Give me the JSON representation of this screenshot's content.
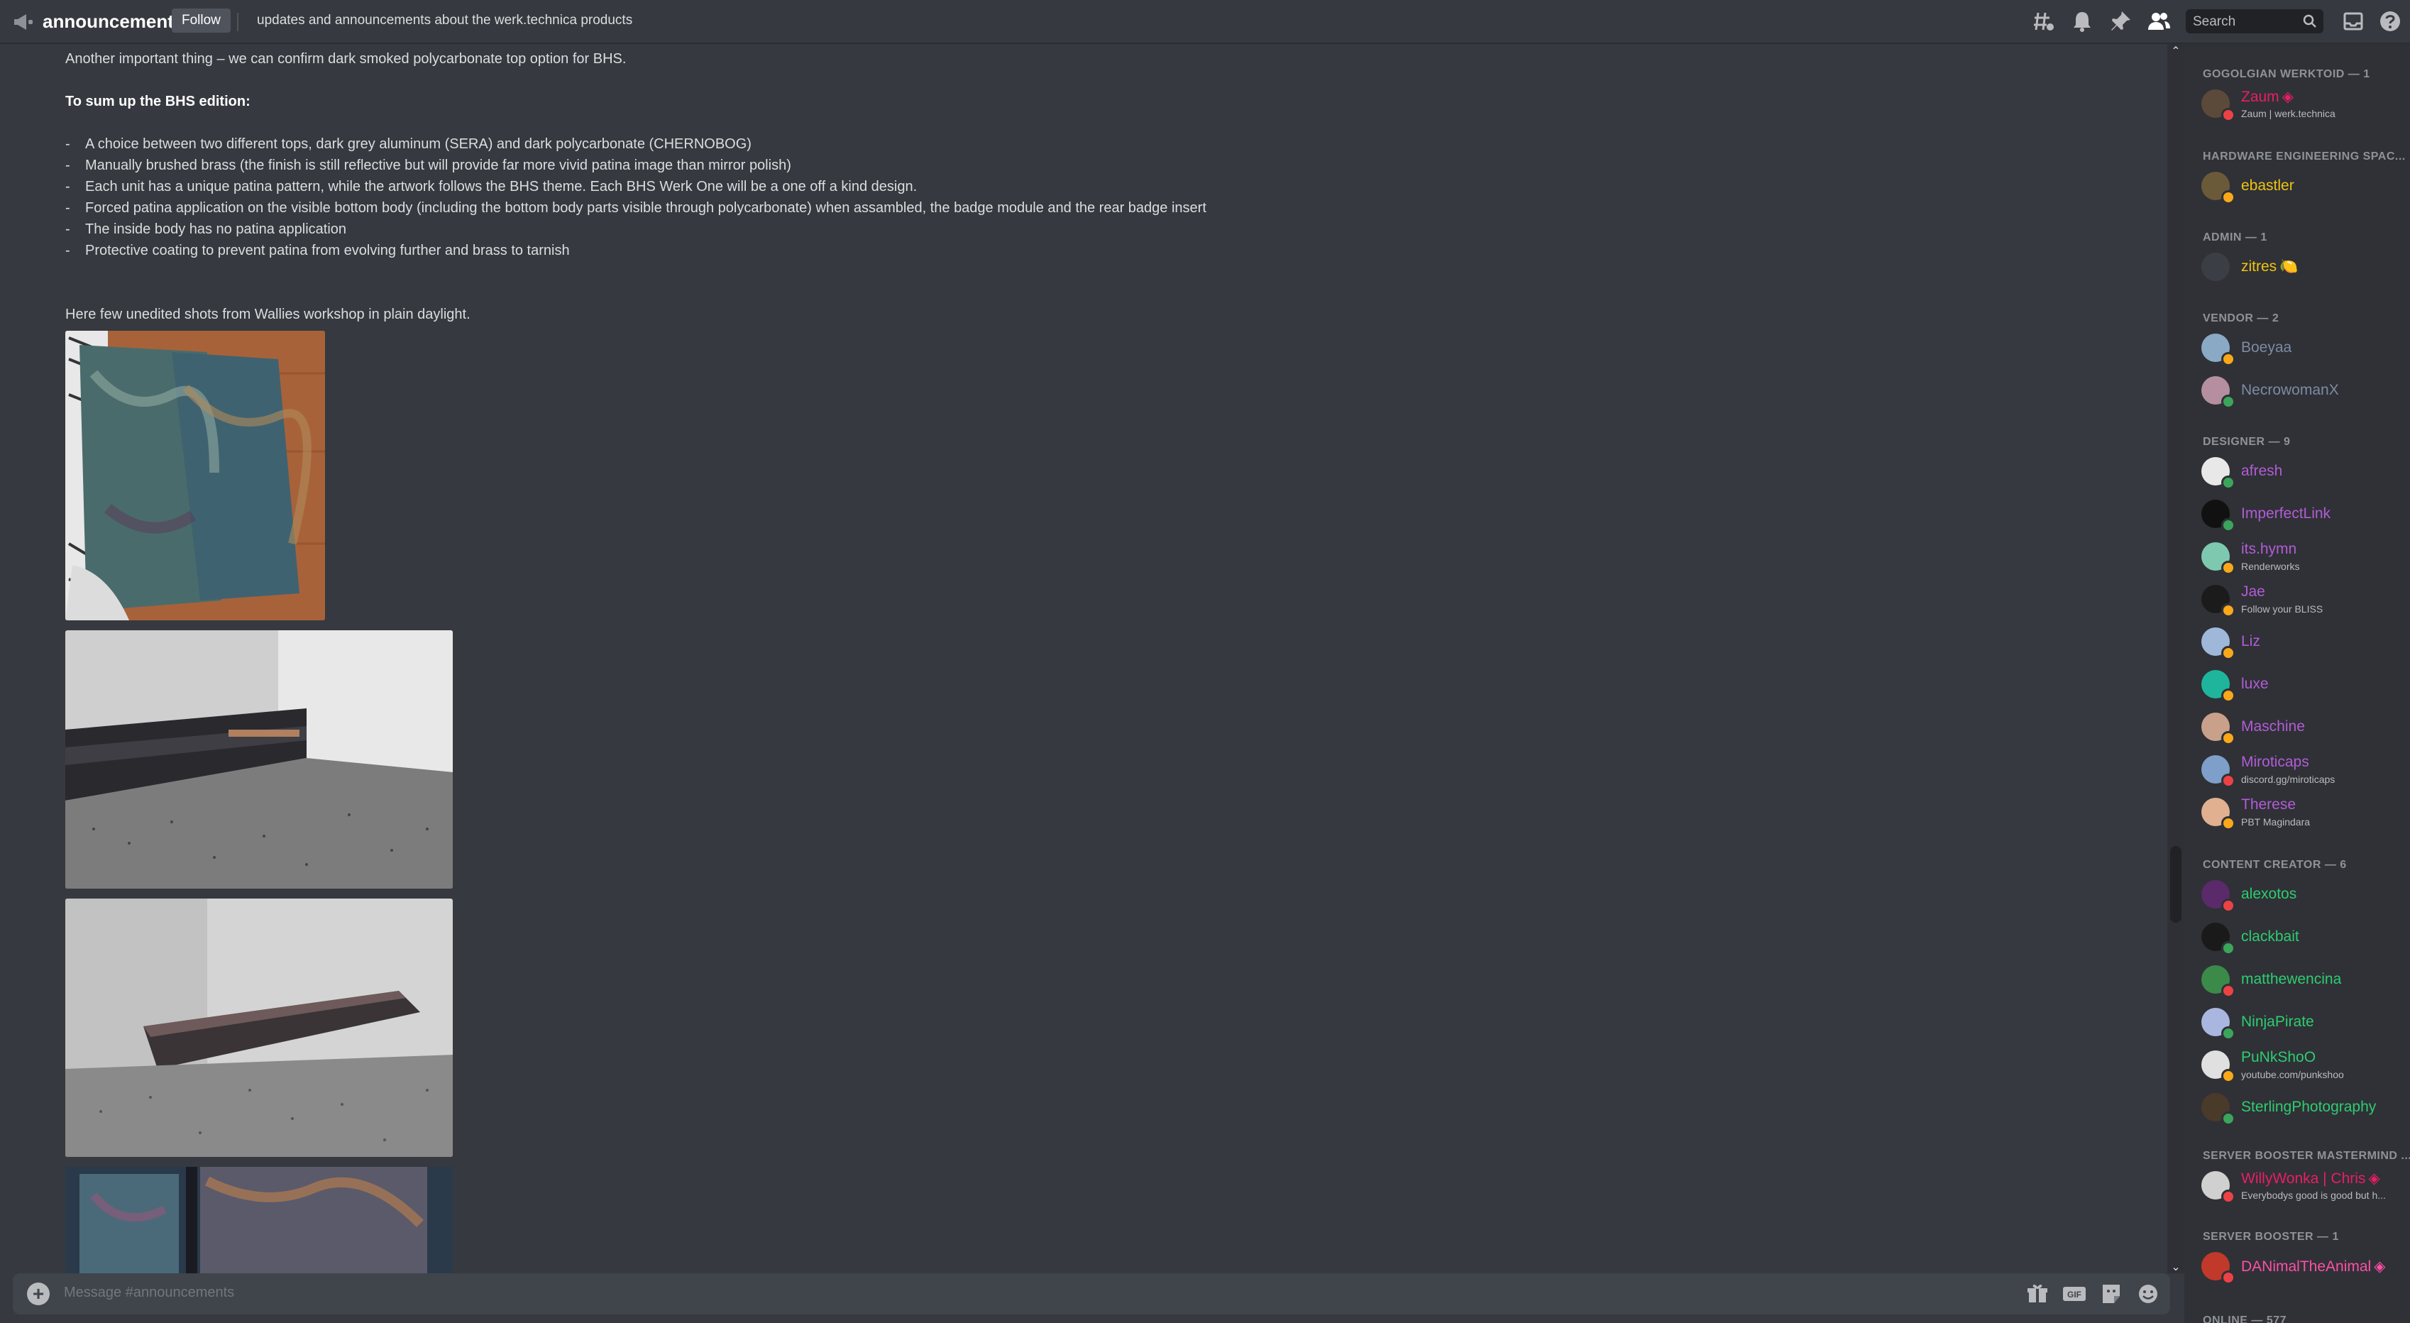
{
  "header": {
    "channel_name": "announcements",
    "follow_label": "Follow",
    "topic": "updates and announcements about the werk.technica products",
    "search_placeholder": "Search"
  },
  "icons": {
    "channel": "megaphone-icon",
    "threads": "threads-icon",
    "notifications": "bell-icon",
    "pins": "pin-icon",
    "members": "members-icon",
    "search": "search-icon",
    "inbox": "inbox-icon",
    "help": "help-icon"
  },
  "message": {
    "intro": "Another important thing – we can confirm dark smoked polycarbonate top option for BHS.",
    "summary_heading": "To sum up the BHS edition:",
    "bullets": [
      "A choice between two different tops, dark grey aluminum (SERA) and dark polycarbonate (CHERNOBOG)",
      "Manually brushed brass (the finish is still reflective but will provide far more vivid patina image than mirror polish)",
      "Each unit has a unique patina pattern, while the artwork follows the BHS theme. Each BHS Werk One will be a one off a kind design.",
      "Forced patina application on the visible bottom body (including the bottom body parts visible through polycarbonate) when assambled, the badge module and the rear badge insert",
      "The inside body has no patina application",
      "Protective coating to prevent patina from evolving further and brass to tarnish"
    ],
    "bullet_marker": "-",
    "photos_caption": "Here few unedited shots from Wallies workshop in plain daylight."
  },
  "composer": {
    "placeholder": "Message #announcements"
  },
  "members": {
    "groups": [
      {
        "title": "GOGOLGIAN WERKTOID — 1",
        "members": [
          {
            "name": "Zaum",
            "sub": "Zaum | werk.technica",
            "color": "#e91e63",
            "status": "#ed4245",
            "avatar": "#5b4a3a",
            "badge": "◈"
          }
        ]
      },
      {
        "title": "HARDWARE ENGINEERING SPAC...",
        "members": [
          {
            "name": "ebastler",
            "sub": "",
            "color": "#f1c40f",
            "status": "#faa81a",
            "avatar": "#6b5a3a"
          }
        ]
      },
      {
        "title": "ADMIN — 1",
        "members": [
          {
            "name": "zitres",
            "sub": "",
            "color": "#f1c40f",
            "status": "",
            "avatar": "#3b3e44",
            "badge": "🍋"
          }
        ]
      },
      {
        "title": "VENDOR — 2",
        "members": [
          {
            "name": "Boeyaa",
            "sub": "",
            "color": "#7e8aa3",
            "status": "#faa81a",
            "avatar": "#8aa9c4"
          },
          {
            "name": "NecrowomanX",
            "sub": "",
            "color": "#7e8aa3",
            "status": "#3ba55c",
            "avatar": "#b58fa0"
          }
        ]
      },
      {
        "title": "DESIGNER — 9",
        "members": [
          {
            "name": "afresh",
            "sub": "",
            "color": "#b25cd6",
            "status": "#3ba55c",
            "avatar": "#e8e8e8"
          },
          {
            "name": "ImperfectLink",
            "sub": "",
            "color": "#b25cd6",
            "status": "#3ba55c",
            "avatar": "#111111"
          },
          {
            "name": "its.hymn",
            "sub": "Renderworks",
            "color": "#b25cd6",
            "status": "#faa81a",
            "avatar": "#7ec8b0"
          },
          {
            "name": "Jae",
            "sub": "Follow your BLISS",
            "color": "#b25cd6",
            "status": "#faa81a",
            "avatar": "#1b1b1b"
          },
          {
            "name": "Liz",
            "sub": "",
            "color": "#b25cd6",
            "status": "#faa81a",
            "avatar": "#9fb7d9"
          },
          {
            "name": "luxe",
            "sub": "",
            "color": "#b25cd6",
            "status": "#faa81a",
            "avatar": "#1fb59c"
          },
          {
            "name": "Maschine",
            "sub": "",
            "color": "#b25cd6",
            "status": "#faa81a",
            "avatar": "#c9a08a"
          },
          {
            "name": "Miroticaps",
            "sub": "discord.gg/miroticaps",
            "color": "#b25cd6",
            "status": "#ed4245",
            "avatar": "#7d9fc9"
          },
          {
            "name": "Therese",
            "sub": "PBT Magindara",
            "color": "#b25cd6",
            "status": "#faa81a",
            "avatar": "#e0b090"
          }
        ]
      },
      {
        "title": "CONTENT CREATOR — 6",
        "members": [
          {
            "name": "alexotos",
            "sub": "",
            "color": "#2ecc71",
            "status": "#ed4245",
            "avatar": "#5a2a6a"
          },
          {
            "name": "clackbait",
            "sub": "",
            "color": "#2ecc71",
            "status": "#3ba55c",
            "avatar": "#1a1a1a"
          },
          {
            "name": "matthewencina",
            "sub": "",
            "color": "#2ecc71",
            "status": "#ed4245",
            "avatar": "#3b8a4a"
          },
          {
            "name": "NinjaPirate",
            "sub": "",
            "color": "#2ecc71",
            "status": "#3ba55c",
            "avatar": "#a9b7e0"
          },
          {
            "name": "PuNkShoO",
            "sub": "youtube.com/punkshoo",
            "color": "#2ecc71",
            "status": "#faa81a",
            "avatar": "#e0e0e0"
          },
          {
            "name": "SterlingPhotography",
            "sub": "",
            "color": "#2ecc71",
            "status": "#3ba55c",
            "avatar": "#4a3a2a"
          }
        ]
      },
      {
        "title": "SERVER BOOSTER MASTERMIND ...",
        "members": [
          {
            "name": "WillyWonka | Chris",
            "sub": "Everybodys good is good but h...",
            "color": "#e91e63",
            "status": "#ed4245",
            "avatar": "#d0d0d0",
            "badge": "◈"
          }
        ]
      },
      {
        "title": "SERVER BOOSTER — 1",
        "members": [
          {
            "name": "DANimalTheAnimal",
            "sub": "",
            "color": "#ff4fa8",
            "status": "#ed4245",
            "avatar": "#c0392b",
            "badge": "◈"
          }
        ]
      },
      {
        "title": "ONLINE — 577",
        "members": []
      }
    ]
  }
}
